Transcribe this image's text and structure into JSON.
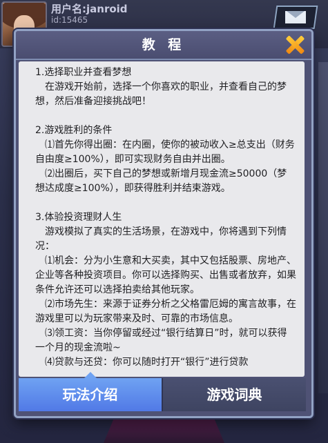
{
  "user": {
    "name_label": "用户名:janroid",
    "id_label": "id:15465"
  },
  "modal": {
    "title": "教 程",
    "close_icon": "close-x-icon"
  },
  "content": {
    "section1": {
      "heading": "1.选择职业并查看梦想",
      "body": "在游戏开始前，选择一个你喜欢的职业，并查看自己的梦想，然后准备迎接挑战吧！"
    },
    "section2": {
      "heading": "2.游戏胜利的条件",
      "item1": "⑴首先你得出圈：在内圈，使你的被动收入≥总支出（财务自由度≥100%），即可实现财务自由并出圈。",
      "item2": "⑵出圈后，买下自己的梦想或新增月现金流≥50000（梦想达成度≥100%），即获得胜利并结束游戏。"
    },
    "section3": {
      "heading": "3.体验投资理财人生",
      "intro": "游戏模拟了真实的生活场景，在游戏中，你将遇到下列情况：",
      "item1": "⑴机会：分为小生意和大买卖，其中又包括股票、房地产、企业等各种投资项目。你可以选择购买、出售或者放弃，如果条件允许还可以选择拍卖给其他玩家。",
      "item2": "⑵市场先生：来源于证券分析之父格雷厄姆的寓言故事，在游戏里可以为玩家带来及时、可靠的市场信息。",
      "item3": "⑶领工资：当你停留或经过“银行结算日”时，就可以获得一个月的现金流啦~",
      "item4": "⑷贷款与还贷：你可以随时打开“银行”进行贷款"
    }
  },
  "tabs": [
    {
      "label": "玩法介绍",
      "active": true
    },
    {
      "label": "游戏词典",
      "active": false
    }
  ],
  "colors": {
    "tab_active": "#5b86ea",
    "tab_inactive": "#444a69",
    "close_icon": "#f5a21a"
  }
}
